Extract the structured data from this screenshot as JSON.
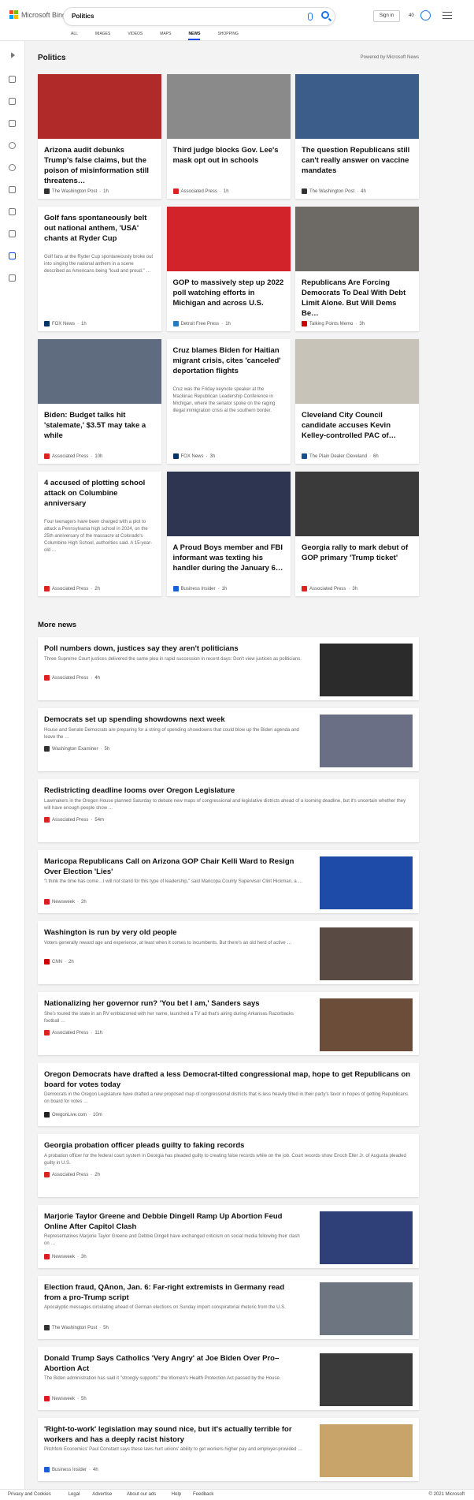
{
  "header": {
    "brand": "Microsoft Bing",
    "query": "Politics",
    "signin": "Sign in",
    "points": "40",
    "tabs": [
      "ALL",
      "IMAGES",
      "VIDEOS",
      "MAPS",
      "NEWS",
      "SHOPPING"
    ],
    "active_tab": "NEWS",
    "icons": {
      "mic": "mic-icon",
      "search": "search-icon",
      "rewards": "rewards-icon",
      "menu": "menu-icon"
    }
  },
  "section": {
    "title": "Politics",
    "powered": "Powered by Microsoft News"
  },
  "cards": [
    {
      "title": "Arizona audit debunks Trump's false claims, but the poison of misinformation still threatens…",
      "source": "The Washington Post",
      "time": "1h",
      "desc": "",
      "img": "#b02a2a"
    },
    {
      "title": "Third judge blocks Gov. Lee's mask opt out in schools",
      "source": "Associated Press",
      "time": "1h",
      "desc": "",
      "img": "#8a8a8a"
    },
    {
      "title": "The question Republicans still can't really answer on vaccine mandates",
      "source": "The Washington Post",
      "time": "4h",
      "desc": "",
      "img": "#3c5c8a"
    },
    {
      "title": "Golf fans spontaneously belt out national anthem, 'USA' chants at Ryder Cup",
      "source": "FOX News",
      "time": "1h",
      "desc": "Golf fans at the Ryder Cup spontaneously broke out into singing the national anthem in a scene described as Americans being \"loud and proud.\" …",
      "img": ""
    },
    {
      "title": "GOP to massively step up 2022 poll watching efforts in Michigan and across U.S.",
      "source": "Detroit Free Press",
      "time": "1h",
      "desc": "",
      "img": "#d2232a"
    },
    {
      "title": "Republicans Are Forcing Democrats To Deal With Debt Limit Alone. But Will Dems Be…",
      "source": "Talking Points Memo",
      "time": "3h",
      "desc": "",
      "img": "#6d6a66"
    },
    {
      "title": "Biden: Budget talks hit 'stalemate,' $3.5T may take a while",
      "source": "Associated Press",
      "time": "10h",
      "desc": "",
      "img": "#5f6c80"
    },
    {
      "title": "Cruz blames Biden for Haitian migrant crisis, cites 'canceled' deportation flights",
      "source": "FOX News",
      "time": "3h",
      "desc": "Cruz was the Friday keynote speaker at the Mackinac Republican Leadership Conference in Michigan, where the senator spoke on the raging illegal immigration crisis at the southern border.",
      "img": ""
    },
    {
      "title": "Cleveland City Council candidate accuses Kevin Kelley-controlled PAC of…",
      "source": "The Plain Dealer Cleveland",
      "time": "6h",
      "desc": "",
      "img": "#c7c3b8"
    },
    {
      "title": "4 accused of plotting school attack on Columbine anniversary",
      "source": "Associated Press",
      "time": "2h",
      "desc": "Four teenagers have been charged with a plot to attack a Pennsylvania high school in 2024, on the 25th anniversary of the massacre at Colorado's Columbine High School, authorities said. A 15-year-old …",
      "img": ""
    },
    {
      "title": "A Proud Boys member and FBI informant was texting his handler during the January 6…",
      "source": "Business Insider",
      "time": "1h",
      "desc": "",
      "img": "#2d3550"
    },
    {
      "title": "Georgia rally to mark debut of GOP primary 'Trump ticket'",
      "source": "Associated Press",
      "time": "3h",
      "desc": "",
      "img": "#3a3a3a"
    }
  ],
  "more": {
    "title": "More news",
    "items": [
      {
        "title": "Poll numbers down, justices say they aren't politicians",
        "desc": "Three Supreme Court justices delivered the same plea in rapid succession in recent days: Don't view justices as politicians.",
        "source": "Associated Press",
        "time": "4h",
        "img": "#2b2b2b"
      },
      {
        "title": "Democrats set up spending showdowns next week",
        "desc": "House and Senate Democrats are preparing for a string of spending showdowns that could blow up the Biden agenda and leave the …",
        "source": "Washington Examiner",
        "time": "5h",
        "img": "#6a6f86"
      },
      {
        "title": "Redistricting deadline looms over Oregon Legislature",
        "desc": "Lawmakers in the Oregon House planned Saturday to debate new maps of congressional and legislative districts ahead of a looming deadline, but it's uncertain whether they will have enough people show …",
        "source": "Associated Press",
        "time": "54m",
        "img": ""
      },
      {
        "title": "Maricopa Republicans Call on Arizona GOP Chair Kelli Ward to Resign Over Election 'Lies'",
        "desc": "\"I think the time has come…I will not stand for this type of leadership,\" said Maricopa County Supervisor Clint Hickman, a …",
        "source": "Newsweek",
        "time": "2h",
        "img": "#1e4aa8"
      },
      {
        "title": "Washington is run by very old people",
        "desc": "Voters generally reward age and experience, at least when it comes to incumbents. But there's an old herd of active …",
        "source": "CNN",
        "time": "2h",
        "img": "#5a4a44"
      },
      {
        "title": "Nationalizing her governor run? 'You bet I am,' Sanders says",
        "desc": "She's toured the state in an RV emblazoned with her name, launched a TV ad that's airing during Arkansas Razorbacks football …",
        "source": "Associated Press",
        "time": "11h",
        "img": "#6b4d3a"
      },
      {
        "title": "Oregon Democrats have drafted a less Democrat-tilted congressional map, hope to get Republicans on board for votes today",
        "desc": "Democrats in the Oregon Legislature have drafted a new proposed map of congressional districts that is less heavily tilted in their party's favor in hopes of getting Republicans on board for votes …",
        "source": "OregonLive.com",
        "time": "10m",
        "img": ""
      },
      {
        "title": "Georgia probation officer pleads guilty to faking records",
        "desc": "A probation officer for the federal court system in Georgia has pleaded guilty to creating false records while on the job. Court records show Enoch Eller Jr. of Augusta pleaded guilty in U.S.",
        "source": "Associated Press",
        "time": "2h",
        "img": ""
      },
      {
        "title": "Marjorie Taylor Greene and Debbie Dingell Ramp Up Abortion Feud Online After Capitol Clash",
        "desc": "Representatives Marjorie Taylor Greene and Debbie Dingell have exchanged criticism on social media following their clash on …",
        "source": "Newsweek",
        "time": "3h",
        "img": "#2f3f78"
      },
      {
        "title": "Election fraud, QAnon, Jan. 6: Far-right extremists in Germany read from a pro-Trump script",
        "desc": "Apocalyptic messages circulating ahead of German elections on Sunday import conspiratorial rhetoric from the U.S.",
        "source": "The Washington Post",
        "time": "5h",
        "img": "#6c7580"
      },
      {
        "title": "Donald Trump Says Catholics 'Very Angry' at Joe Biden Over Pro–Abortion Act",
        "desc": "The Biden administration has said it \"strongly supports\" the Women's Health Protection Act passed by the House.",
        "source": "Newsweek",
        "time": "5h",
        "img": "#3b3b3b"
      },
      {
        "title": "'Right-to-work' legislation may sound nice, but it's actually terrible for workers and has a deeply racist history",
        "desc": "Pitchfork Economics' Paul Constant says these laws hurt unions' ability to get workers higher pay and employer-provided …",
        "source": "Business Insider",
        "time": "4h",
        "img": "#c9a46a"
      }
    ]
  },
  "footer": {
    "links": [
      "Privacy and Cookies",
      "Legal",
      "Advertise",
      "About our ads",
      "Help",
      "Feedback"
    ],
    "copyright": "© 2021 Microsoft"
  }
}
